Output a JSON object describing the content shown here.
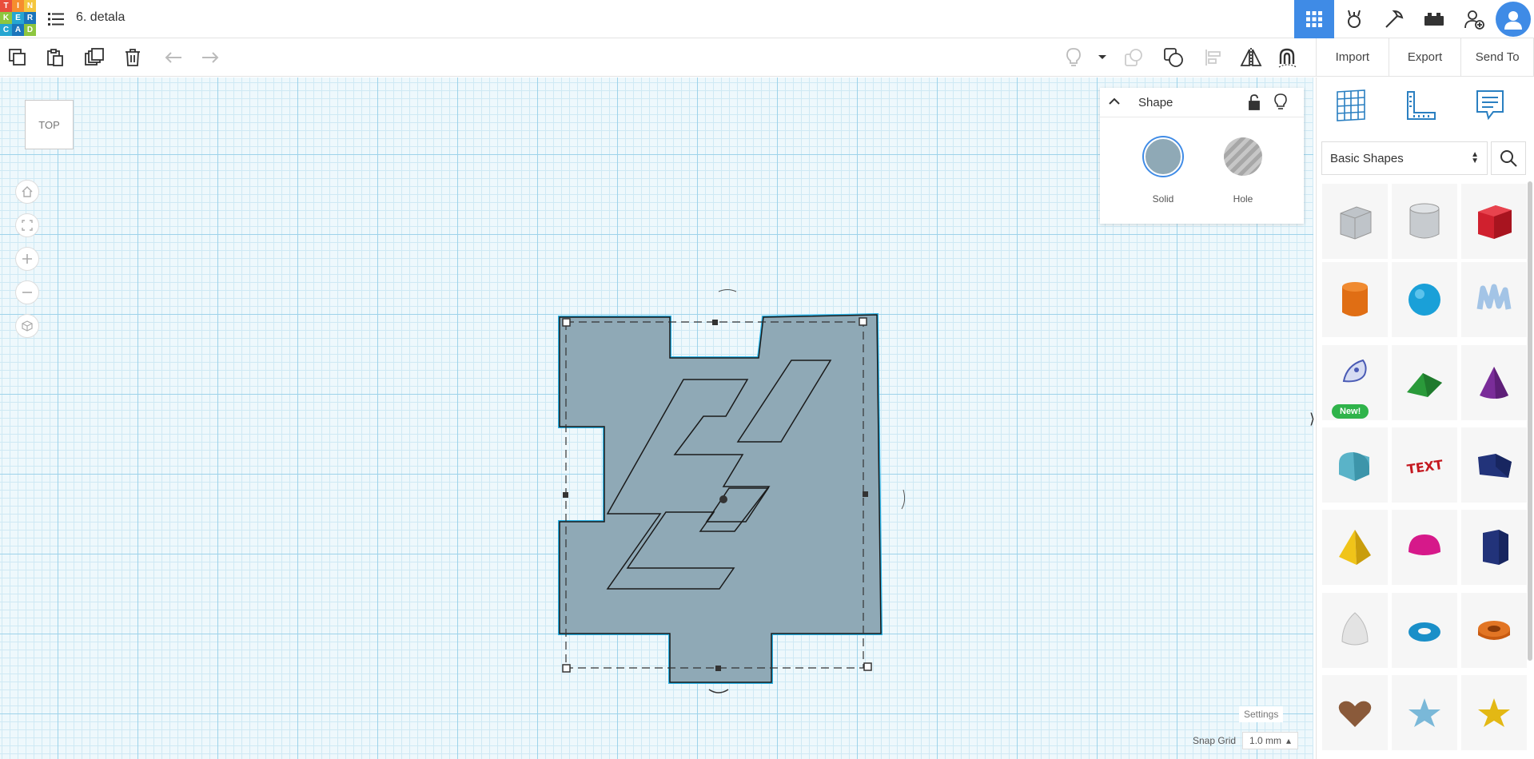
{
  "app": {
    "logo_letters": [
      "T",
      "I",
      "N",
      "K",
      "E",
      "R",
      "C",
      "A",
      "D"
    ],
    "design_title": "6. detala"
  },
  "topbar_icons": [
    "3d-design-icon",
    "codeblocks-icon",
    "circuits-icon",
    "bricks-icon",
    "invite-user-icon",
    "profile-icon"
  ],
  "toolbar": {
    "copy": "copy-icon",
    "paste": "paste-icon",
    "duplicate": "duplicate-icon",
    "delete": "delete-icon",
    "undo": "undo-icon",
    "redo": "redo-icon"
  },
  "import_bar": {
    "import_label": "Import",
    "export_label": "Export",
    "sendto_label": "Send To"
  },
  "viewcube": {
    "label": "TOP"
  },
  "shape_panel": {
    "title": "Shape",
    "solid_label": "Solid",
    "hole_label": "Hole",
    "solid_color": "#8fa9b6"
  },
  "library": {
    "selected": "Basic Shapes",
    "new_badge": "New!"
  },
  "workplane": {
    "settings_label": "Settings",
    "snap_label": "Snap Grid",
    "snap_value": "1.0 mm"
  },
  "colors": {
    "accent": "#3f8be6",
    "selection": "#2ab4e8",
    "shape_fill": "#8fa9b6"
  },
  "shapes": [
    "box",
    "cylinder-hole",
    "box-red",
    "cylinder",
    "sphere",
    "scribble",
    "shape-generator",
    "roof",
    "cone",
    "round-roof",
    "text",
    "wedge",
    "pyramid",
    "half-sphere",
    "polygon",
    "paraboloid",
    "torus",
    "tube",
    "heart",
    "star-hole",
    "star"
  ]
}
